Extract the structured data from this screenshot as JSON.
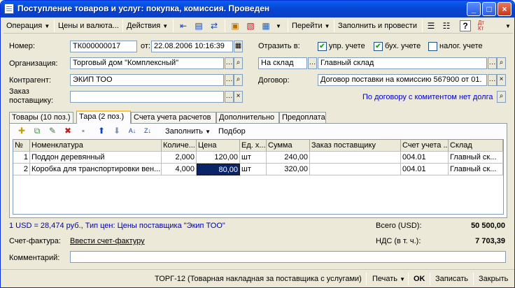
{
  "window": {
    "title": "Поступление товаров и услуг: покупка, комиссия. Проведен",
    "minimize": "_",
    "maximize": "□",
    "close": "×"
  },
  "toolbar": {
    "operation": "Операция",
    "prices": "Цены и валюта...",
    "actions": "Действия",
    "goto": "Перейти",
    "fill_post": "Заполнить и провести",
    "help": "?",
    "dtkt": "Дт Кт"
  },
  "form": {
    "number_label": "Номер:",
    "number": "ТК000000017",
    "date_label": "от:",
    "date": "22.08.2006 10:16:39",
    "reflect_label": "Отразить в:",
    "upr_label": "упр. учете",
    "buh_label": "бух. учете",
    "nal_label": "налог. учете",
    "upr_checked": true,
    "buh_checked": true,
    "nal_checked": false,
    "org_label": "Организация:",
    "org": "Торговый дом \"Комплексный\"",
    "warehouse_type": "На склад",
    "warehouse": "Главный склад",
    "contractor_label": "Контрагент:",
    "contractor": "ЭКИП ТОО",
    "contract_label": "Договор:",
    "contract": "Договор поставки на комиссию 567900 от 01.",
    "order_label_1": "Заказ",
    "order_label_2": "поставщику:",
    "order": "",
    "debt_link": "По договору с комитентом нет долга"
  },
  "tabs": [
    {
      "label": "Товары (10 поз.)"
    },
    {
      "label": "Тара (2 поз.)"
    },
    {
      "label": "Счета учета расчетов"
    },
    {
      "label": "Дополнительно"
    },
    {
      "label": "Предоплата"
    }
  ],
  "grid_toolbar": {
    "fill": "Заполнить",
    "pick": "Подбор"
  },
  "grid": {
    "columns": [
      "№",
      "Номенклатура",
      "Количе...",
      "Цена",
      "Ед. х...",
      "Сумма",
      "Заказ поставщику",
      "Счет учета ...",
      "Склад"
    ],
    "rows": [
      [
        "1",
        "Поддон деревянный",
        "2,000",
        "120,00",
        "шт",
        "240,00",
        "",
        "004.01",
        "Главный ск..."
      ],
      [
        "2",
        "Коробка для транспортировки вен...",
        "4,000",
        "80,00",
        "шт",
        "320,00",
        "",
        "004.01",
        "Главный ск..."
      ]
    ]
  },
  "footer": {
    "rate_info": "1 USD = 28,474 руб., Тип цен: Цены поставщика \"Экип ТОО\"",
    "total_label": "Всего (USD):",
    "total": "50 500,00",
    "invoice_label": "Счет-фактура:",
    "invoice_link": "Ввести счет-фактуру",
    "vat_label": "НДС (в т. ч.):",
    "vat": "7 703,39",
    "comment_label": "Комментарий:",
    "comment": ""
  },
  "statusbar": {
    "torg": "ТОРГ-12 (Товарная накладная за поставщика с услугами)",
    "print": "Печать",
    "ok": "OK",
    "save": "Записать",
    "close": "Закрыть"
  }
}
